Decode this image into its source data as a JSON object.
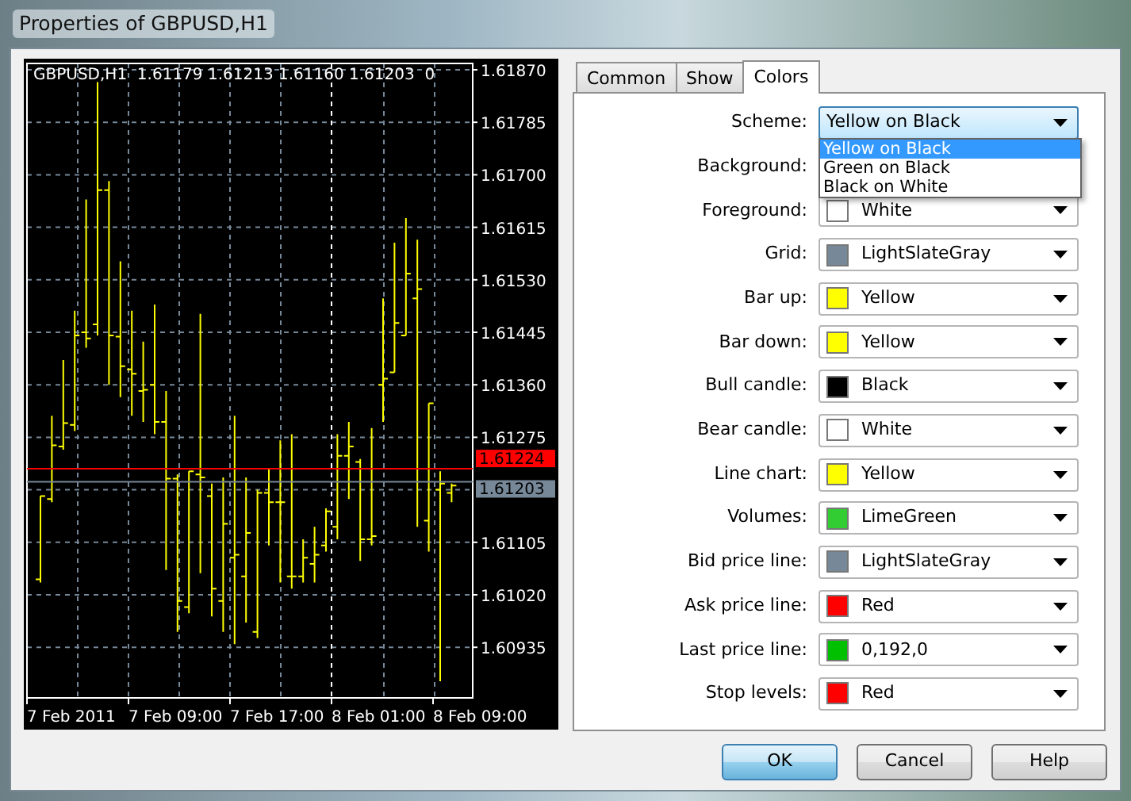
{
  "window": {
    "title": "Properties of GBPUSD,H1"
  },
  "chart": {
    "header": "GBPUSD,H1  1.61179 1.61213 1.61160 1.61203  0",
    "price_labels": [
      "1.61870",
      "1.61785",
      "1.61700",
      "1.61615",
      "1.61530",
      "1.61445",
      "1.61360",
      "1.61275",
      "1.61105",
      "1.61020",
      "1.60935"
    ],
    "time_labels": [
      "7 Feb 2011",
      "7 Feb 09:00",
      "7 Feb 17:00",
      "8 Feb 01:00",
      "8 Feb 09:00"
    ],
    "ask_label": "1.61224",
    "bid_label": "1.61203"
  },
  "tabs": [
    {
      "label": "Common",
      "selected": false
    },
    {
      "label": "Show",
      "selected": false
    },
    {
      "label": "Colors",
      "selected": true
    }
  ],
  "scheme": {
    "label": "Scheme:",
    "value": "Yellow on Black",
    "expanded": true,
    "options": [
      {
        "label": "Yellow on Black",
        "selected": true
      },
      {
        "label": "Green on Black",
        "selected": false
      },
      {
        "label": "Black on White",
        "selected": false
      }
    ]
  },
  "colors": [
    {
      "label": "Background:"
    },
    {
      "label": "Foreground:",
      "value": "White",
      "color": "#ffffff"
    },
    {
      "label": "Grid:",
      "value": "LightSlateGray",
      "color": "#778899"
    },
    {
      "label": "Bar up:",
      "value": "Yellow",
      "color": "#ffff00"
    },
    {
      "label": "Bar down:",
      "value": "Yellow",
      "color": "#ffff00"
    },
    {
      "label": "Bull candle:",
      "value": "Black",
      "color": "#000000"
    },
    {
      "label": "Bear candle:",
      "value": "White",
      "color": "#ffffff"
    },
    {
      "label": "Line chart:",
      "value": "Yellow",
      "color": "#ffff00"
    },
    {
      "label": "Volumes:",
      "value": "LimeGreen",
      "color": "#32cd32"
    },
    {
      "label": "Bid price line:",
      "value": "LightSlateGray",
      "color": "#778899"
    },
    {
      "label": "Ask price line:",
      "value": "Red",
      "color": "#ff0000"
    },
    {
      "label": "Last price line:",
      "value": "0,192,0",
      "color": "#00c000"
    },
    {
      "label": "Stop levels:",
      "value": "Red",
      "color": "#ff0000"
    }
  ],
  "buttons": [
    {
      "label": "OK",
      "default": true
    },
    {
      "label": "Cancel",
      "default": false
    },
    {
      "label": "Help",
      "default": false
    }
  ]
}
